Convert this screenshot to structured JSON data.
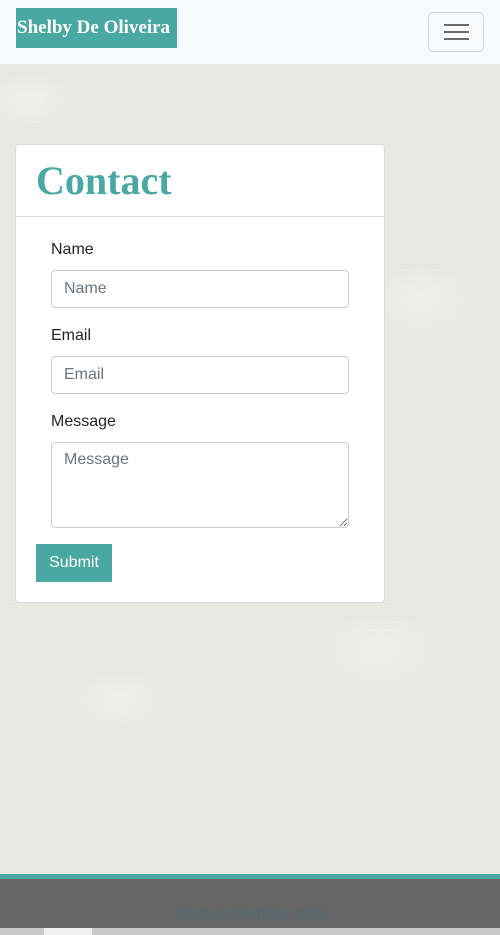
{
  "navbar": {
    "brand": "Shelby De Oliveira",
    "toggler_icon": "hamburger-menu-icon"
  },
  "contact": {
    "title": "Contact",
    "name_label": "Name",
    "name_placeholder": "Name",
    "email_label": "Email",
    "email_placeholder": "Email",
    "message_label": "Message",
    "message_placeholder": "Message",
    "submit_label": "Submit"
  },
  "footer": {
    "text": "Shelby's Portfolio 2020"
  },
  "colors": {
    "accent": "#4aa8a2",
    "footer_bg": "#666666",
    "navbar_bg": "#f8f9fa"
  }
}
